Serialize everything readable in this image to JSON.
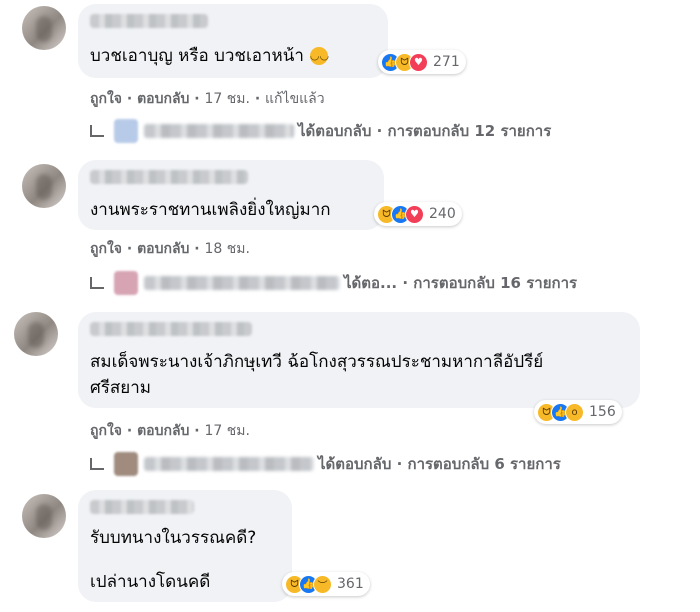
{
  "comments": [
    {
      "text_lines": [
        "บวชเอาบุญ หรือ บวชเอาหน้า"
      ],
      "emoji": "😔",
      "reaction_icons": [
        "like",
        "haha",
        "love"
      ],
      "reaction_count": "271",
      "actions": {
        "like": "ถูกใจ",
        "reply": "ตอบกลับ",
        "time": "17 ชม.",
        "edited": "แก้ไขแล้ว"
      },
      "replies": "ได้ตอบกลับ · การตอบกลับ 12 รายการ"
    },
    {
      "text_lines": [
        "งานพระราชทานเพลิงยิ่งใหญ่มาก"
      ],
      "reaction_icons": [
        "haha",
        "like",
        "love"
      ],
      "reaction_count": "240",
      "actions": {
        "like": "ถูกใจ",
        "reply": "ตอบกลับ",
        "time": "18 ชม."
      },
      "replies": "ได้ตอ... · การตอบกลับ 16 รายการ"
    },
    {
      "text_lines": [
        "สมเด็จพระนางเจ้าภิกษุเทวี ฉ้อโกงสุวรรณประชามหากาลีอัปรีย์",
        "ศรีสยาม"
      ],
      "reaction_icons": [
        "haha",
        "like",
        "wow"
      ],
      "reaction_count": "156",
      "actions": {
        "like": "ถูกใจ",
        "reply": "ตอบกลับ",
        "time": "17 ชม."
      },
      "replies": "ได้ตอบกลับ · การตอบกลับ 6 รายการ"
    },
    {
      "text_lines": [
        "รับบทนางในวรรณคดี?",
        "เปล่านางโดนคดี"
      ],
      "reaction_icons": [
        "haha",
        "like",
        "sad"
      ],
      "reaction_count": "361"
    }
  ],
  "colors": {
    "like": "#1877f2",
    "love": "#f33e58",
    "haha": "#f7b928",
    "meta": "#65676b",
    "bubble": "#f0f2f5"
  }
}
